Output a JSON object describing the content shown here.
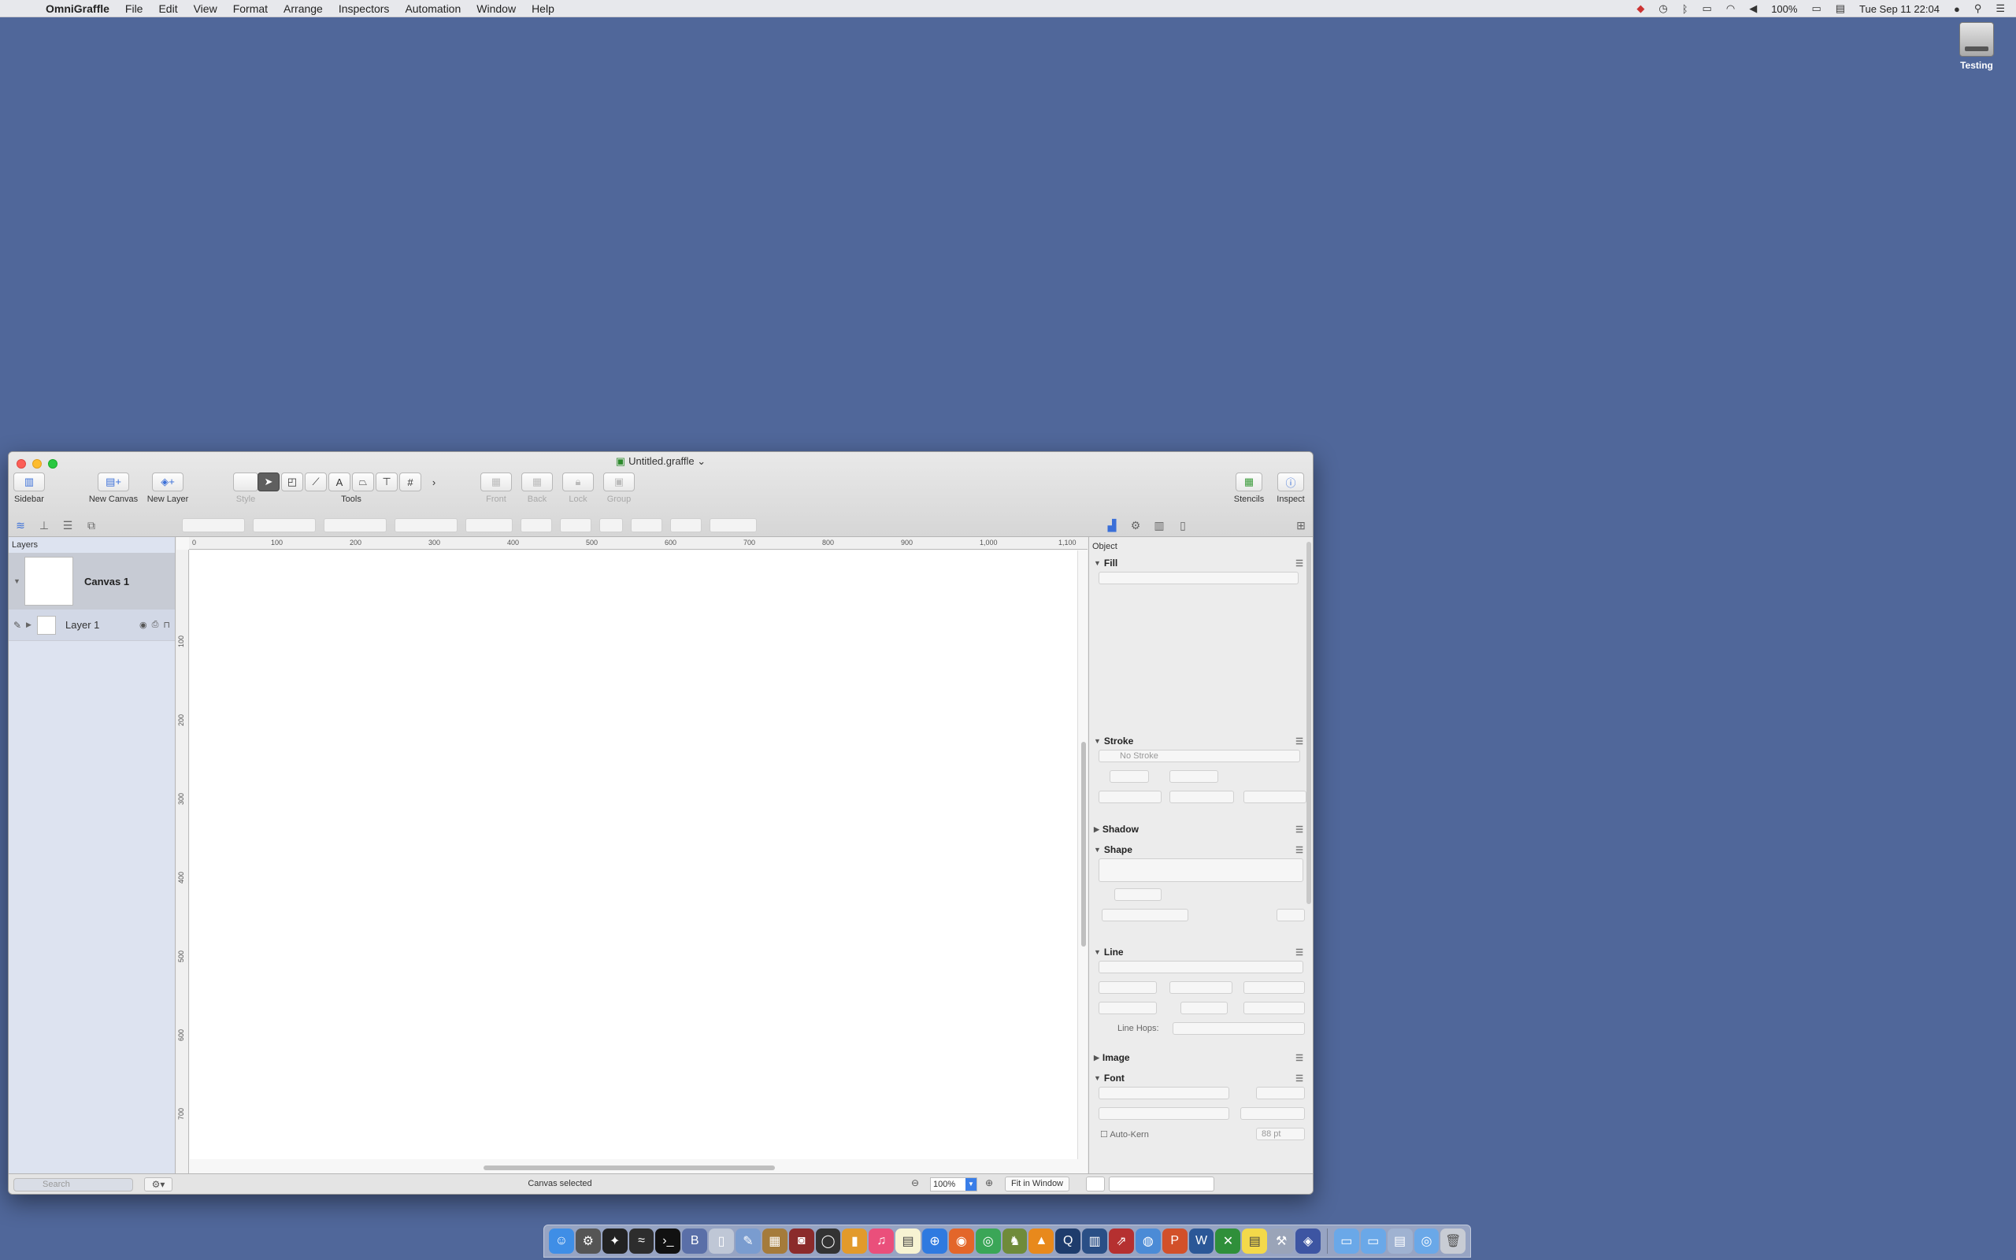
{
  "menubar": {
    "app_name": "OmniGraffle",
    "menus": [
      "File",
      "Edit",
      "View",
      "Format",
      "Arrange",
      "Inspectors",
      "Automation",
      "Window",
      "Help"
    ],
    "battery": "100%",
    "datetime": "Tue Sep 11  22:04"
  },
  "desktop": {
    "drive_label": "Testing"
  },
  "window": {
    "title": "Untitled.graffle",
    "toolbar": {
      "sidebar": "Sidebar",
      "new_canvas": "New Canvas",
      "new_layer": "New Layer",
      "style": "Style",
      "tools": "Tools",
      "front": "Front",
      "back": "Back",
      "lock": "Lock",
      "group": "Group",
      "stencils": "Stencils",
      "inspect": "Inspect"
    },
    "sidebar": {
      "header": "Layers",
      "canvas_name": "Canvas 1",
      "layer_name": "Layer 1"
    },
    "ruler": {
      "h_ticks": [
        "0",
        "100",
        "200",
        "300",
        "400",
        "500",
        "600",
        "700",
        "800",
        "900",
        "1,000",
        "1,100"
      ],
      "v_ticks": [
        "100",
        "200",
        "300",
        "400",
        "500",
        "600",
        "700"
      ]
    },
    "inspector": {
      "label": "Object",
      "fill": "Fill",
      "stroke": "Stroke",
      "no_stroke": "No Stroke",
      "shadow": "Shadow",
      "shape": "Shape",
      "line": "Line",
      "line_hops": "Line Hops:",
      "image": "Image",
      "font": "Font",
      "auto_kern": "Auto-Kern",
      "kern_value": "88 pt"
    },
    "status": {
      "search_placeholder": "Search",
      "message": "Canvas selected",
      "zoom": "100%",
      "fit": "Fit in Window"
    }
  }
}
